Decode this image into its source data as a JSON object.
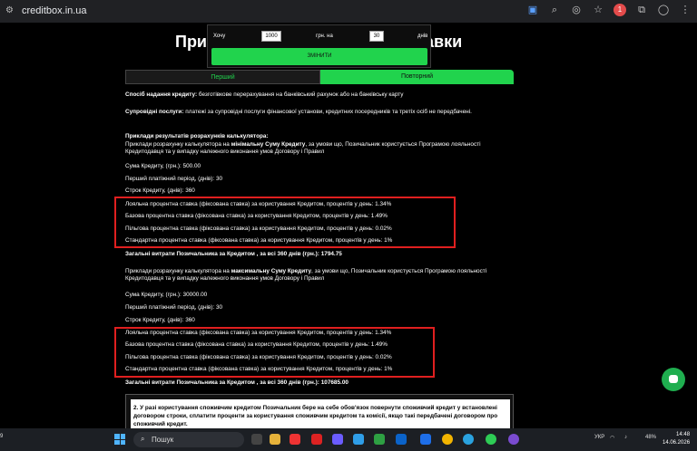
{
  "browser": {
    "url": "creditbox.in.ua"
  },
  "page": {
    "title_left": "Прик",
    "title_right": "авки"
  },
  "calculator": {
    "want_label": "Хочу",
    "amount_value": "1000",
    "currency_label": "грн. на",
    "days_value": "30",
    "days_label": "днів",
    "change_button": "ЗМІНИТИ"
  },
  "tabs": [
    {
      "label": "Перший"
    },
    {
      "label": "Повторний"
    }
  ],
  "content": {
    "method_label": "Спосіб надання кредиту:",
    "method_text": " безготівкове перерахування на банківський рахунок або на банківську карту",
    "services_label": "Супровідні послуги:",
    "services_text": " платежі за супровідні послуги фінансової установи, кредитних посередників та третіх осіб не передбачені.",
    "examples_heading": "Приклади результатів розрахунків калькулятора:",
    "ex1_text_a": "Приклади розрахунку калькулятора на ",
    "ex1_bold": "мінімальну Суму Кредиту",
    "ex1_text_b": ", за умови що, Позичальник користується Програмою лояльності Кредитодавця та у випадку належного виконання умов Договору і Правил",
    "ex1_sum": "Сума Кредиту, (грн.): 500.00",
    "ex1_period": "Перший платіжний період, (днів): 30",
    "ex1_term": "Строк Кредиту, (днів): 360",
    "ex1_rates": [
      "Лояльна процентна ставка (фіксована ставка) за користування Кредитом, процентів у день: 1.34%",
      "Базова процентна ставка (фіксована ставка) за користування Кредитом, процентів у день: 1.49%",
      "Пільгова процентна ставка (фіксована ставка) за користування Кредитом, процентів у день: 0.02%",
      "Стандартна процентна ставка (фіксована ставка) за користування Кредитом, процентів у день: 1%"
    ],
    "ex1_total": "Загальні витрати Позичальника за Кредитом , за всі 360 днів (грн.): 1794.75",
    "ex2_text_a": "Приклади розрахунку калькулятора на ",
    "ex2_bold": "максимальну Суму Кредиту",
    "ex2_text_b": ", за умови що, Позичальник користується Програмою лояльності Кредитодавця та у випадку належного виконання умов Договору і Правил",
    "ex2_sum": "Сума Кредиту, (грн.): 30000.00",
    "ex2_period": "Перший платіжний період, (днів): 30",
    "ex2_term": "Строк Кредиту, (днів): 360",
    "ex2_rates": [
      "Лояльна процентна ставка (фіксована ставка) за користування Кредитом, процентів у день: 1.34%",
      "Базова процентна ставка (фіксована ставка) за користування Кредитом, процентів у день: 1.49%",
      "Пільгова процентна ставка (фіксована ставка) за користування Кредитом, процентів у день: 0.02%",
      "Стандартна процентна ставка (фіксована ставка) за користування Кредитом, процентів у день: 1%"
    ],
    "ex2_total": "Загальні витрати Позичальника за Кредитом , за всі 360 днів (грн.): 107685.00",
    "info_text": "2. У разі користування споживчим кредитом Позичальник бере на себе обов'язок повернути споживчий кредит у встановлені договором строки, сплатити проценти за користування споживчим кредитом та комісії, якщо такі передбачені договором про споживчий кредит."
  },
  "taskbar": {
    "left_number": "9",
    "search_placeholder": "Пошук",
    "lang": "УКР",
    "battery": "48%",
    "time": "14:48",
    "date": "14.06.2026"
  }
}
